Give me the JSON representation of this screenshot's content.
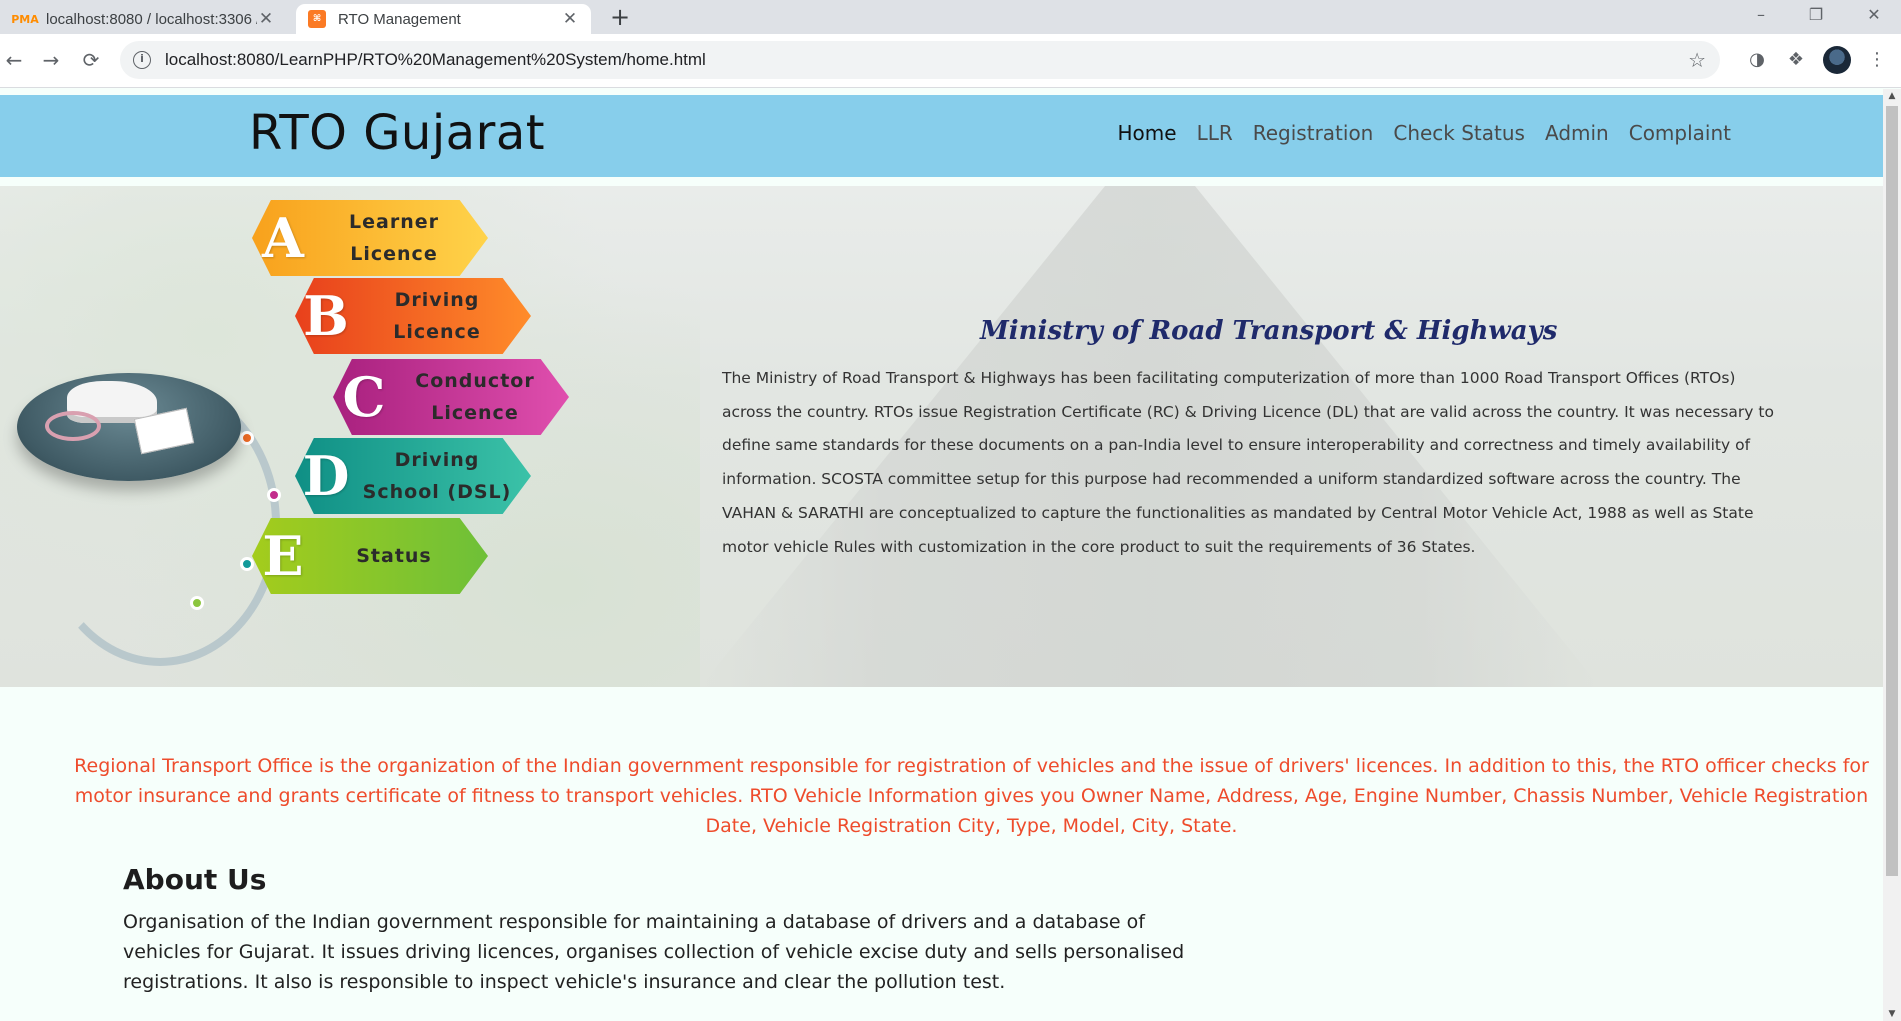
{
  "browser": {
    "tabs": [
      {
        "title": "localhost:8080 / localhost:3306 /",
        "favicon": "phpmyadmin-icon",
        "active": false
      },
      {
        "title": "RTO Management",
        "favicon": "xampp-icon",
        "active": true
      }
    ],
    "favicon_text": {
      "pma": "PMA",
      "xampp": "⌘"
    },
    "close_glyph": "✕",
    "new_tab_glyph": "+",
    "window_controls": {
      "minimize": "–",
      "restore": "❐",
      "close": "✕"
    },
    "nav_glyphs": {
      "back": "←",
      "forward": "→",
      "reload": "⟳"
    },
    "info_glyph": "i",
    "url": "localhost:8080/LearnPHP/RTO%20Management%20System/home.html",
    "star_glyph": "☆",
    "extension_glyphs": {
      "extension1": "◑",
      "extensions": "❖",
      "menu": "⋮"
    },
    "scroll_arrows": {
      "up": "▲",
      "down": "▼"
    }
  },
  "site": {
    "brand": "RTO Gujarat",
    "nav": [
      {
        "label": "Home",
        "active": true
      },
      {
        "label": "LLR",
        "active": false
      },
      {
        "label": "Registration",
        "active": false
      },
      {
        "label": "Check Status",
        "active": false
      },
      {
        "label": "Admin",
        "active": false
      },
      {
        "label": "Complaint",
        "active": false
      }
    ]
  },
  "hero": {
    "services": [
      {
        "letter": "A",
        "label": "Learner\nLicence",
        "color_from": "#f8a11c",
        "color_to": "#ffd34a"
      },
      {
        "letter": "B",
        "label": "Driving\nLicence",
        "color_from": "#e8401c",
        "color_to": "#ff8c2a"
      },
      {
        "letter": "C",
        "label": "Conductor\nLicence",
        "color_from": "#a8207e",
        "color_to": "#e04fae"
      },
      {
        "letter": "D",
        "label": "Driving\nSchool (DSL)",
        "color_from": "#0f8f85",
        "color_to": "#3bc2a8"
      },
      {
        "letter": "E",
        "label": "Status",
        "color_from": "#a4cc1c",
        "color_to": "#6ec038"
      }
    ],
    "dot_colors": [
      "#f2a81f",
      "#ee6a24",
      "#c32d8c",
      "#129a9a",
      "#8cc63f"
    ],
    "ministry_title": "Ministry of Road Transport & Highways",
    "ministry_text": "The Ministry of Road Transport & Highways has been facilitating computerization of more than 1000 Road Transport Offices (RTOs) across the country. RTOs issue Registration Certificate (RC) & Driving Licence (DL) that are valid across the country. It was necessary to define same standards for these documents on a pan-India level to ensure interoperability and correctness and timely availability of information. SCOSTA committee setup for this purpose had recommended a uniform standardized software across the country. The VAHAN & SARATHI are conceptualized to capture the functionalities as mandated by Central Motor Vehicle Act, 1988 as well as State motor vehicle Rules with customization in the core product to suit the requirements of 36 States."
  },
  "intro_text": "Regional Transport Office is the organization of the Indian government responsible for registration of vehicles and the issue of drivers' licences. In addition to this, the RTO officer checks for motor insurance and grants certificate of fitness to transport vehicles. RTO Vehicle Information gives you Owner Name, Address, Age, Engine Number, Chassis Number, Vehicle Registration Date, Vehicle Registration City, Type, Model, City, State.",
  "about": {
    "title": "About Us",
    "text": "Organisation of the Indian government responsible for maintaining a database of drivers and a database of vehicles for Gujarat. It issues driving licences, organises collection of vehicle excise duty and sells personalised registrations. It also is responsible to inspect vehicle's insurance and clear the pollution test."
  },
  "colors": {
    "header_bg": "#87ceeb",
    "intro_text": "#ee4c2c",
    "ministry_title": "#1f2a6b",
    "page_bg": "#f6fffb"
  }
}
